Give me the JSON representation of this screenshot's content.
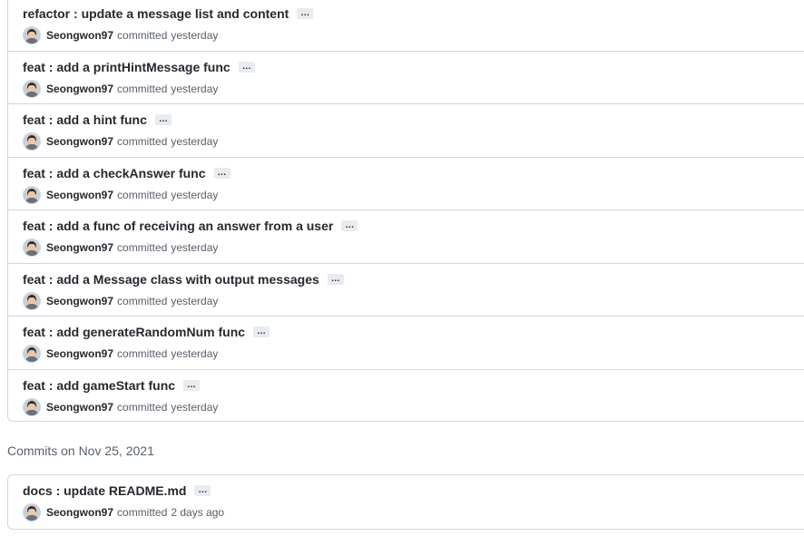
{
  "commit_group_1": {
    "commits": [
      {
        "message": "refactor : update a message list and content",
        "author": "Seongwon97",
        "action": "committed",
        "time": "yesterday"
      },
      {
        "message": "feat : add a printHintMessage func",
        "author": "Seongwon97",
        "action": "committed",
        "time": "yesterday"
      },
      {
        "message": "feat : add a hint func",
        "author": "Seongwon97",
        "action": "committed",
        "time": "yesterday"
      },
      {
        "message": "feat : add a checkAnswer func",
        "author": "Seongwon97",
        "action": "committed",
        "time": "yesterday"
      },
      {
        "message": "feat : add a func of receiving an answer from a user",
        "author": "Seongwon97",
        "action": "committed",
        "time": "yesterday"
      },
      {
        "message": "feat : add a Message class with output messages",
        "author": "Seongwon97",
        "action": "committed",
        "time": "yesterday"
      },
      {
        "message": "feat : add generateRandomNum func",
        "author": "Seongwon97",
        "action": "committed",
        "time": "yesterday"
      },
      {
        "message": "feat : add gameStart func",
        "author": "Seongwon97",
        "action": "committed",
        "time": "yesterday"
      }
    ]
  },
  "commit_group_2": {
    "heading": "Commits on Nov 25, 2021",
    "commits": [
      {
        "message": "docs : update README.md",
        "author": "Seongwon97",
        "action": "committed",
        "time": "2 days ago"
      }
    ]
  },
  "ellipsis_label": "…",
  "icons": {
    "avatar": "user-avatar",
    "ellipsis": "ellipsis-icon"
  },
  "colors": {
    "border": "#d0d7de",
    "text": "#24292f",
    "muted": "#57606a",
    "ellipsis_bg": "#e8ebef"
  }
}
